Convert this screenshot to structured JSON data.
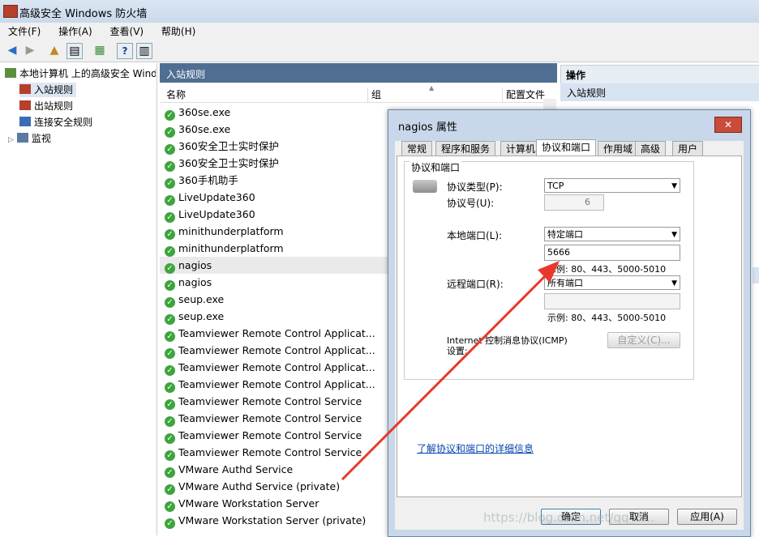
{
  "window": {
    "title": "高级安全 Windows 防火墙"
  },
  "menu": [
    "文件(F)",
    "操作(A)",
    "查看(V)",
    "帮助(H)"
  ],
  "tree": {
    "root": "本地计算机 上的高级安全 Windows 防火墙",
    "items": [
      "入站规则",
      "出站规则",
      "连接安全规则",
      "监视"
    ]
  },
  "middle": {
    "header": "入站规则",
    "columns": [
      "名称",
      "组",
      "配置文件"
    ],
    "rows": [
      "360se.exe",
      "360se.exe",
      "360安全卫士实时保护",
      "360安全卫士实时保护",
      "360手机助手",
      "LiveUpdate360",
      "LiveUpdate360",
      "minithunderplatform",
      "minithunderplatform",
      "nagios",
      "nagios",
      "seup.exe",
      "seup.exe",
      "Teamviewer Remote Control Applicat...",
      "Teamviewer Remote Control Applicat...",
      "Teamviewer Remote Control Applicat...",
      "Teamviewer Remote Control Applicat...",
      "Teamviewer Remote Control Service",
      "Teamviewer Remote Control Service",
      "Teamviewer Remote Control Service",
      "Teamviewer Remote Control Service",
      "VMware Authd Service",
      "VMware Authd Service (private)",
      "VMware Workstation Server",
      "VMware Workstation Server (private)"
    ],
    "selected_index": 9
  },
  "right": {
    "header": "操作",
    "sub": "入站规则"
  },
  "dialog": {
    "title": "nagios 属性",
    "close": "✕",
    "tabs": [
      "常规",
      "程序和服务",
      "计算机",
      "协议和端口",
      "作用域",
      "高级",
      "用户"
    ],
    "active_tab": 3,
    "group_label": "协议和端口",
    "protocol_type_label": "协议类型(P):",
    "protocol_type_value": "TCP",
    "protocol_number_label": "协议号(U):",
    "protocol_number_value": "6",
    "local_port_label": "本地端口(L):",
    "local_port_value": "特定端口",
    "local_port_input": "5666",
    "example": "示例: 80、443、5000-5010",
    "remote_port_label": "远程端口(R):",
    "remote_port_value": "所有端口",
    "icmp_label": "Internet 控制消息协议(ICMP)设置:",
    "customize_button": "自定义(C)...",
    "link": "了解协议和端口的详细信息",
    "ok_button": "确定",
    "cancel_button": "取消",
    "apply_button": "应用(A)"
  },
  "colors": {
    "header_blue": "#4f6e92",
    "arrow_red": "#e8382c",
    "check_green": "#3ea43c"
  }
}
